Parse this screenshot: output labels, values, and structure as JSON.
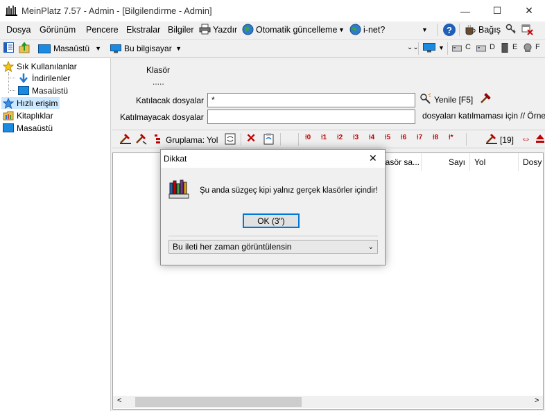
{
  "window": {
    "title": "MeinPlatz 7.57 - Admin - [Bilgilendirme - Admin]",
    "minimize": "—",
    "maximize": "☐",
    "close": "✕"
  },
  "menu": {
    "items": [
      "Dosya",
      "Görünüm",
      "Pencere",
      "Ekstralar",
      "Bilgiler"
    ],
    "print": "Yazdır",
    "update": "Otomatik güncelleme",
    "inet": "i-net?",
    "help": "?",
    "donate": "Bağış"
  },
  "address": {
    "location1": "Masaüstü",
    "location2": "Bu bilgisayar",
    "drives": [
      "C",
      "D",
      "E",
      "F"
    ]
  },
  "sidebar": {
    "items": [
      {
        "label": "Sık Kullanılanlar",
        "icon": "star-icon"
      },
      {
        "label": "İndirilenler",
        "icon": "download-icon"
      },
      {
        "label": "Masaüstü",
        "icon": "desktop-icon"
      },
      {
        "label": "Hızlı erişim",
        "icon": "star-blue-icon"
      },
      {
        "label": "Kitaplıklar",
        "icon": "library-icon"
      },
      {
        "label": "Masaüstü",
        "icon": "desktop-icon"
      }
    ]
  },
  "filter": {
    "folder_label": "Klasör",
    "folder_value": ".....",
    "include_label": "Katılacak dosyalar",
    "include_value": "*",
    "exclude_label": "Katılmayacak dosyalar",
    "exclude_value": "",
    "refresh": "Yenile [F5]",
    "exclude_hint": "dosyaları katılmaması için // Örne"
  },
  "toolbar2": {
    "grouping": "Gruplama: Yol",
    "numbers": [
      "0",
      "1",
      "2",
      "3",
      "4",
      "5",
      "6",
      "7",
      "8",
      "*"
    ],
    "count": "[19]"
  },
  "columns": [
    "lasör sa...",
    "Sayı",
    "Yol",
    "Dosy"
  ],
  "dialog": {
    "title": "Dikkat",
    "message": "Şu anda süzgeç kipi yalnız gerçek klasörler içindir!",
    "ok": "OK (3\")",
    "option": "Bu ileti her zaman görüntülensin",
    "close": "✕"
  }
}
